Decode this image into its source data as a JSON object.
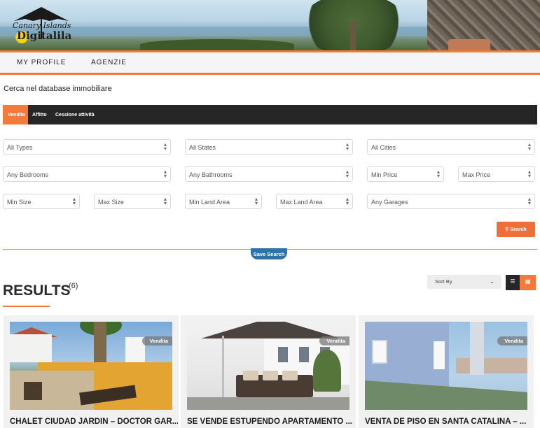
{
  "header": {
    "logo_line1": "Canary Islands",
    "logo_line2": "Digitalila"
  },
  "nav": {
    "items": [
      {
        "label": "MY PROFILE"
      },
      {
        "label": "AGENZIE"
      }
    ]
  },
  "page": {
    "subtitle": "Cerca nel database immobiliare"
  },
  "search": {
    "tabs": [
      {
        "label": "Vendita",
        "active": true
      },
      {
        "label": "Affitto",
        "active": false
      },
      {
        "label": "Cessione attività",
        "active": false
      }
    ],
    "fields": {
      "types": "All Types",
      "states": "All States",
      "cities": "All Cities",
      "bedrooms": "Any Bedrooms",
      "bathrooms": "Any Bathrooms",
      "min_price": "Min Price",
      "max_price": "Max Price",
      "min_size": "Min Size",
      "max_size": "Max Size",
      "min_land": "Min Land Area",
      "max_land": "Max Land Area",
      "garages": "Any Garages"
    },
    "search_button": "Search",
    "save_search": "Save Search"
  },
  "results": {
    "title": "RESULTS",
    "count": "(6)",
    "sort_label": "Sort By"
  },
  "listings": [
    {
      "badge": "Vendita",
      "title": "CHALET CIUDAD JARDIN – DOCTOR GAR..."
    },
    {
      "badge": "Vendita",
      "title": "SE VENDE ESTUPENDO APARTAMENTO ..."
    },
    {
      "badge": "Vendita",
      "title": "VENTA DE PISO EN SANTA CATALINA – ..."
    }
  ],
  "colors": {
    "accent": "#f47a3a",
    "dark_bar": "#262626",
    "save_search_blue": "#2b73a8"
  },
  "icons": {
    "select_arrows": "up-down-arrows-icon",
    "search": "magnifier-icon",
    "sort_chevron": "chevron-down-icon",
    "list_view": "list-view-icon",
    "grid_view": "grid-view-icon"
  }
}
